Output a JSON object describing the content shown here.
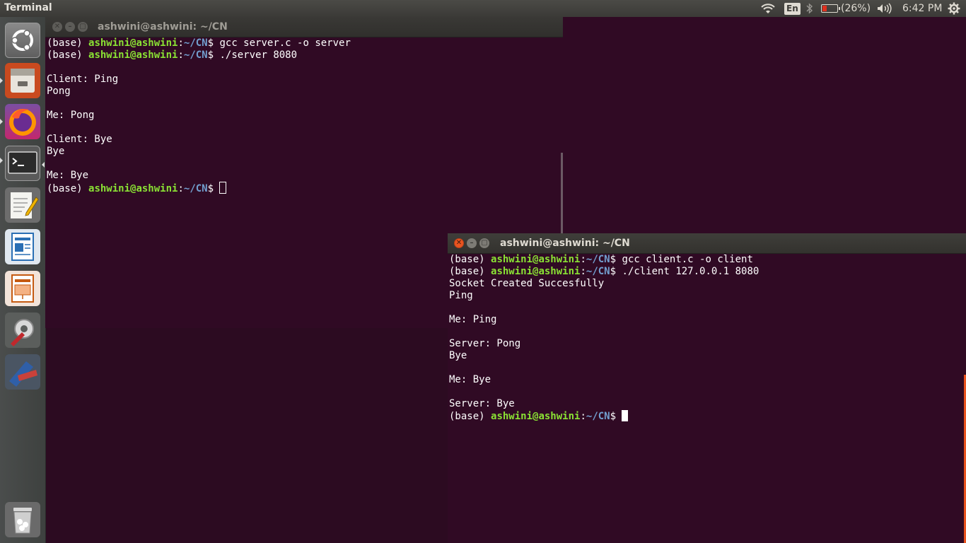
{
  "top_panel": {
    "app_title": "Terminal",
    "wifi_icon": "wifi-icon",
    "language": "En",
    "bluetooth_icon": "bluetooth-icon",
    "battery_icon": "battery-low-icon",
    "battery_percent": "(26%)",
    "volume_icon": "volume-icon",
    "time": "6:42 PM",
    "settings_icon": "gear-icon"
  },
  "launcher": {
    "items": [
      {
        "name": "Search your computer",
        "icon": "ubuntu-logo-icon"
      },
      {
        "name": "Files",
        "icon": "files-icon"
      },
      {
        "name": "Firefox Web Browser",
        "icon": "firefox-icon"
      },
      {
        "name": "Terminal",
        "icon": "terminal-icon"
      },
      {
        "name": "Text Editor",
        "icon": "text-editor-icon"
      },
      {
        "name": "LibreOffice Writer",
        "icon": "writer-icon"
      },
      {
        "name": "LibreOffice Impress",
        "icon": "impress-icon"
      },
      {
        "name": "System Settings",
        "icon": "system-settings-icon"
      },
      {
        "name": "Cisco Packet Tracer",
        "icon": "packet-tracer-icon"
      },
      {
        "name": "Trash",
        "icon": "trash-icon"
      }
    ]
  },
  "server_window": {
    "title": "ashwini@ashwini: ~/CN",
    "lines": [
      {
        "prefix": "(base) ",
        "user": "ashwini@ashwini",
        "colon": ":",
        "path": "~/CN",
        "prompt": "$ ",
        "cmd": "gcc server.c -o server"
      },
      {
        "prefix": "(base) ",
        "user": "ashwini@ashwini",
        "colon": ":",
        "path": "~/CN",
        "prompt": "$ ",
        "cmd": "./server 8080"
      },
      {
        "text": ""
      },
      {
        "text": "Client: Ping"
      },
      {
        "text": "Pong"
      },
      {
        "text": ""
      },
      {
        "text": "Me: Pong"
      },
      {
        "text": ""
      },
      {
        "text": "Client: Bye"
      },
      {
        "text": "Bye"
      },
      {
        "text": ""
      },
      {
        "text": "Me: Bye"
      },
      {
        "prefix": "(base) ",
        "user": "ashwini@ashwini",
        "colon": ":",
        "path": "~/CN",
        "prompt": "$ ",
        "cmd": "",
        "cursor": "hollow"
      }
    ]
  },
  "client_window": {
    "title": "ashwini@ashwini: ~/CN",
    "lines": [
      {
        "prefix": "(base) ",
        "user": "ashwini@ashwini",
        "colon": ":",
        "path": "~/CN",
        "prompt": "$ ",
        "cmd": "gcc client.c -o client"
      },
      {
        "prefix": "(base) ",
        "user": "ashwini@ashwini",
        "colon": ":",
        "path": "~/CN",
        "prompt": "$ ",
        "cmd": "./client 127.0.0.1 8080"
      },
      {
        "text": "Socket Created Succesfully"
      },
      {
        "text": "Ping"
      },
      {
        "text": ""
      },
      {
        "text": "Me: Ping"
      },
      {
        "text": ""
      },
      {
        "text": "Server: Pong"
      },
      {
        "text": "Bye"
      },
      {
        "text": ""
      },
      {
        "text": "Me: Bye"
      },
      {
        "text": ""
      },
      {
        "text": "Server: Bye"
      },
      {
        "prefix": "(base) ",
        "user": "ashwini@ashwini",
        "colon": ":",
        "path": "~/CN",
        "prompt": "$ ",
        "cmd": "",
        "cursor": "block"
      }
    ]
  },
  "colors": {
    "terminal_bg": "#300a24",
    "prompt_user": "#8ae234",
    "prompt_path": "#729fcf",
    "close_button": "#e95420"
  }
}
